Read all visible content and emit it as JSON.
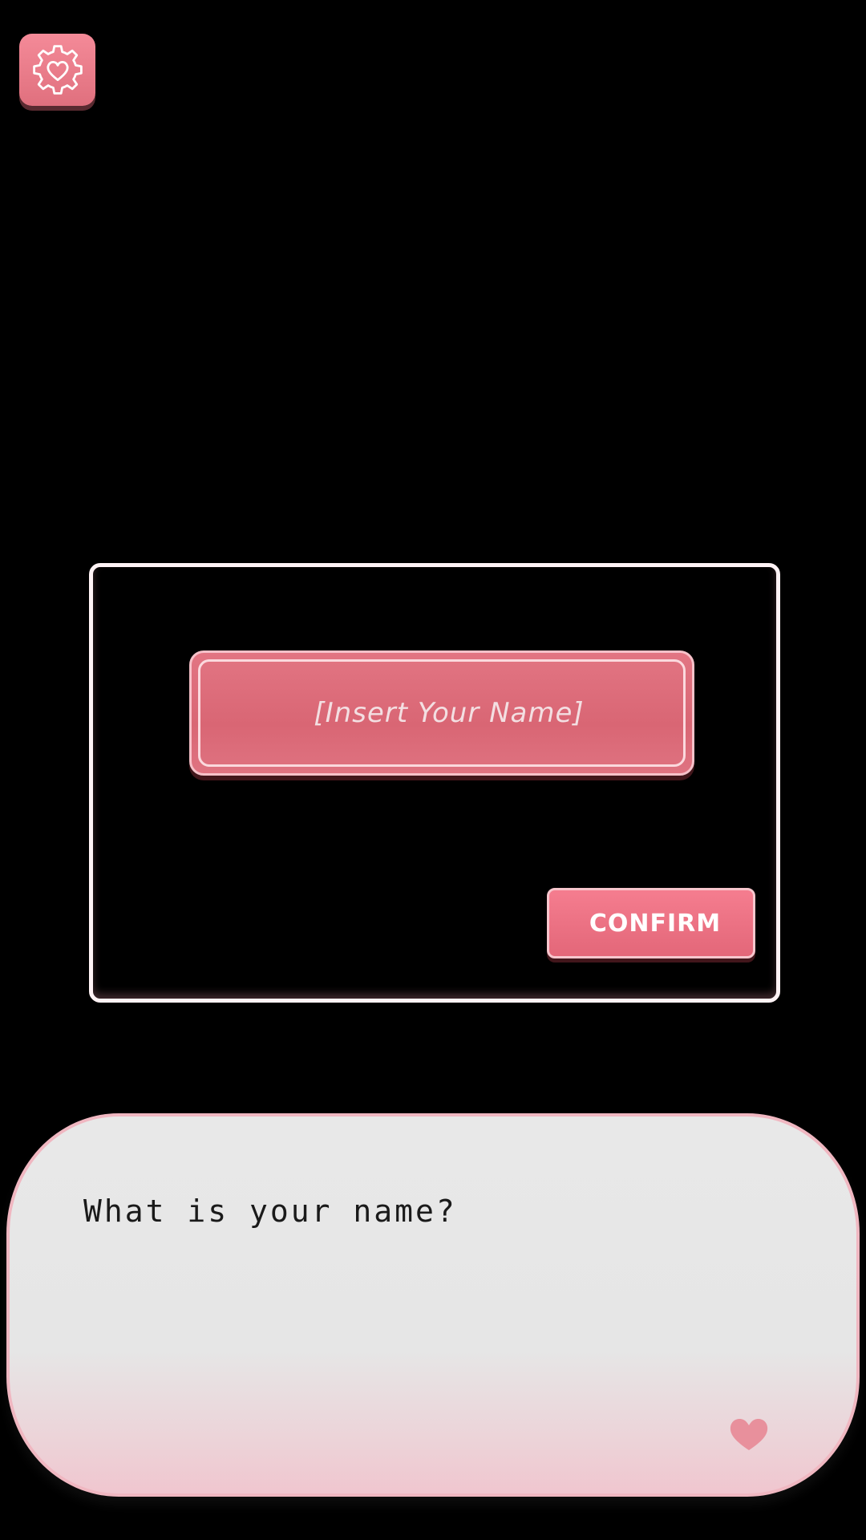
{
  "settings": {
    "icon": "gear-heart-icon"
  },
  "name_panel": {
    "input_placeholder": "[Insert Your Name]",
    "input_value": "",
    "confirm_label": "CONFIRM"
  },
  "dialogue": {
    "text": "What is your name?",
    "advance_icon": "heart-icon"
  },
  "colors": {
    "background": "#000000",
    "accent_pink": "#e36779",
    "panel_border": "#fff3f5",
    "dialogue_bg": "#e8e8e8",
    "heart": "#e8909c"
  }
}
